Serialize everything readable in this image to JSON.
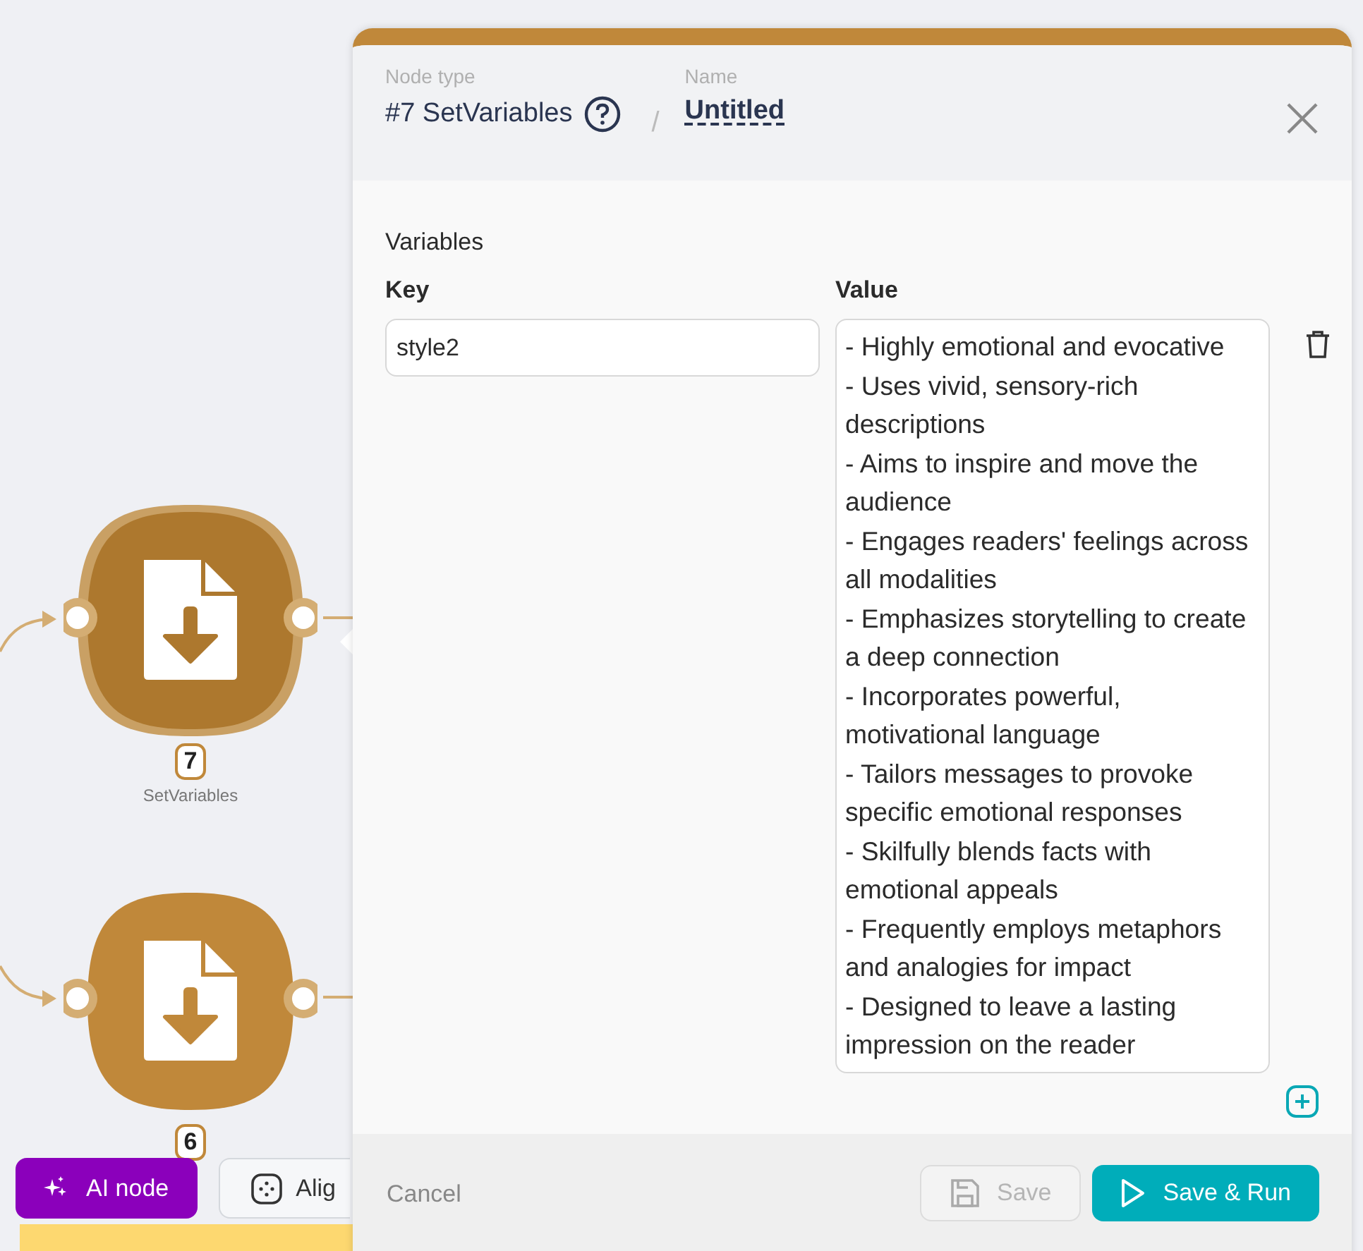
{
  "canvas": {
    "nodes": [
      {
        "number": "7",
        "label": "SetVariables",
        "selected": true
      },
      {
        "number": "6",
        "selected": false
      }
    ],
    "toolbar": [
      {
        "kind": "ai",
        "label": "AI node"
      },
      {
        "kind": "align",
        "label": "Alig"
      }
    ]
  },
  "panel": {
    "node_type_label": "Node type",
    "node_type": "#7 SetVariables",
    "separator": "/",
    "name_label": "Name",
    "name": "Untitled",
    "section": "Variables",
    "key_header": "Key",
    "value_header": "Value",
    "variables": [
      {
        "key": "style2",
        "value": "- Highly emotional and evocative\n- Uses vivid, sensory-rich descriptions\n- Aims to inspire and move the audience\n- Engages readers' feelings across all modalities\n- Emphasizes storytelling to create a deep connection\n- Incorporates powerful, motivational language\n- Tailors messages to provoke specific emotional responses\n- Skilfully blends facts with emotional appeals\n- Frequently employs metaphors and analogies for impact\n- Designed to leave a lasting impression on the reader"
      }
    ],
    "buttons": [
      {
        "kind": "cancel",
        "label": "Cancel",
        "disabled": false
      },
      {
        "kind": "save",
        "label": "Save",
        "disabled": true
      },
      {
        "kind": "run",
        "label": "Save & Run",
        "disabled": false
      }
    ]
  }
}
